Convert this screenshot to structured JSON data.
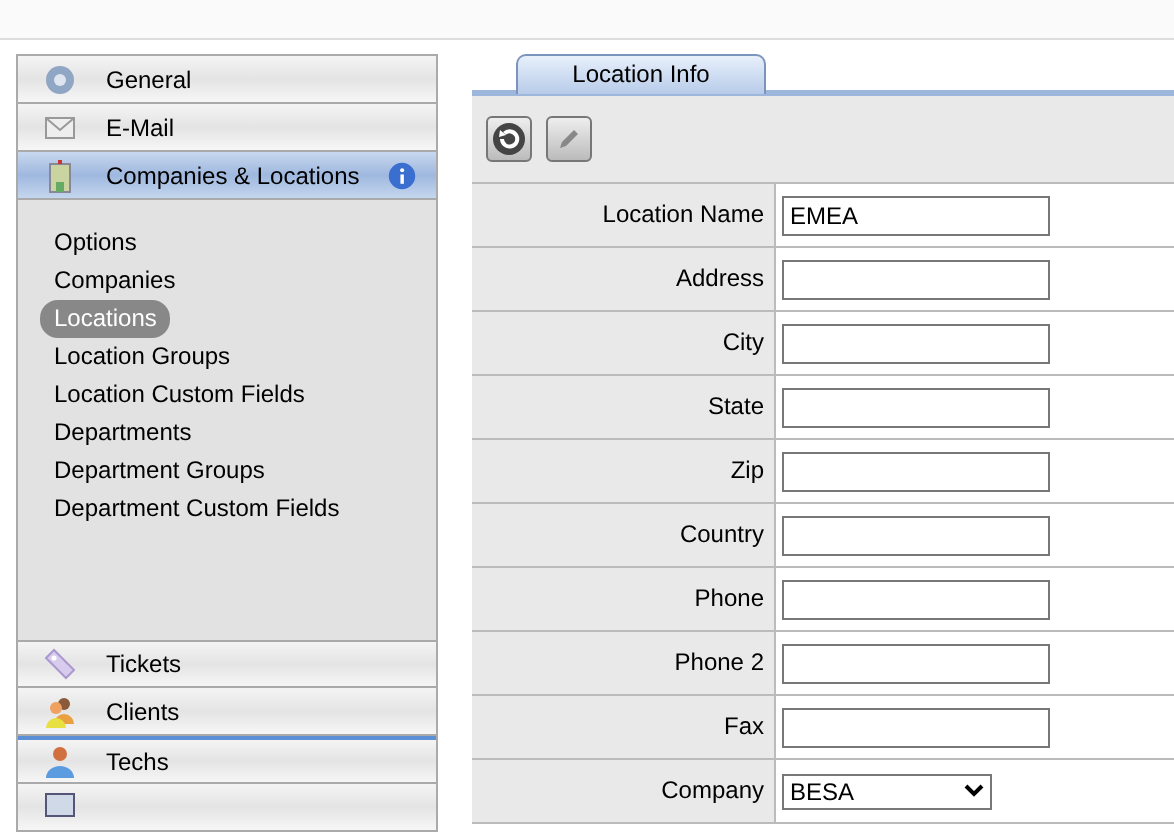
{
  "sidebar": {
    "sections": [
      {
        "label": "General",
        "selected": false
      },
      {
        "label": "E-Mail",
        "selected": false
      },
      {
        "label": "Companies & Locations",
        "selected": true,
        "info": true,
        "items": [
          {
            "label": "Options",
            "selected": false
          },
          {
            "label": "Companies",
            "selected": false
          },
          {
            "label": "Locations",
            "selected": true
          },
          {
            "label": "Location Groups",
            "selected": false
          },
          {
            "label": "Location Custom Fields",
            "selected": false
          },
          {
            "label": "Departments",
            "selected": false
          },
          {
            "label": "Department Groups",
            "selected": false
          },
          {
            "label": "Department Custom Fields",
            "selected": false
          }
        ]
      }
    ],
    "bottom_sections": [
      {
        "label": "Tickets"
      },
      {
        "label": "Clients"
      },
      {
        "label": "Techs"
      }
    ]
  },
  "tabs": [
    {
      "label": "Location Info",
      "selected": true
    }
  ],
  "form": {
    "fields": [
      {
        "label": "Location Name",
        "kind": "text",
        "value": "EMEA"
      },
      {
        "label": "Address",
        "kind": "text"
      },
      {
        "label": "City",
        "kind": "text"
      },
      {
        "label": "State",
        "kind": "text"
      },
      {
        "label": "Zip",
        "kind": "text"
      },
      {
        "label": "Country",
        "kind": "text"
      },
      {
        "label": "Phone",
        "kind": "text"
      },
      {
        "label": "Phone 2",
        "kind": "text"
      },
      {
        "label": "Fax",
        "kind": "text"
      },
      {
        "label": "Company",
        "kind": "select",
        "value": "BESA"
      }
    ]
  }
}
